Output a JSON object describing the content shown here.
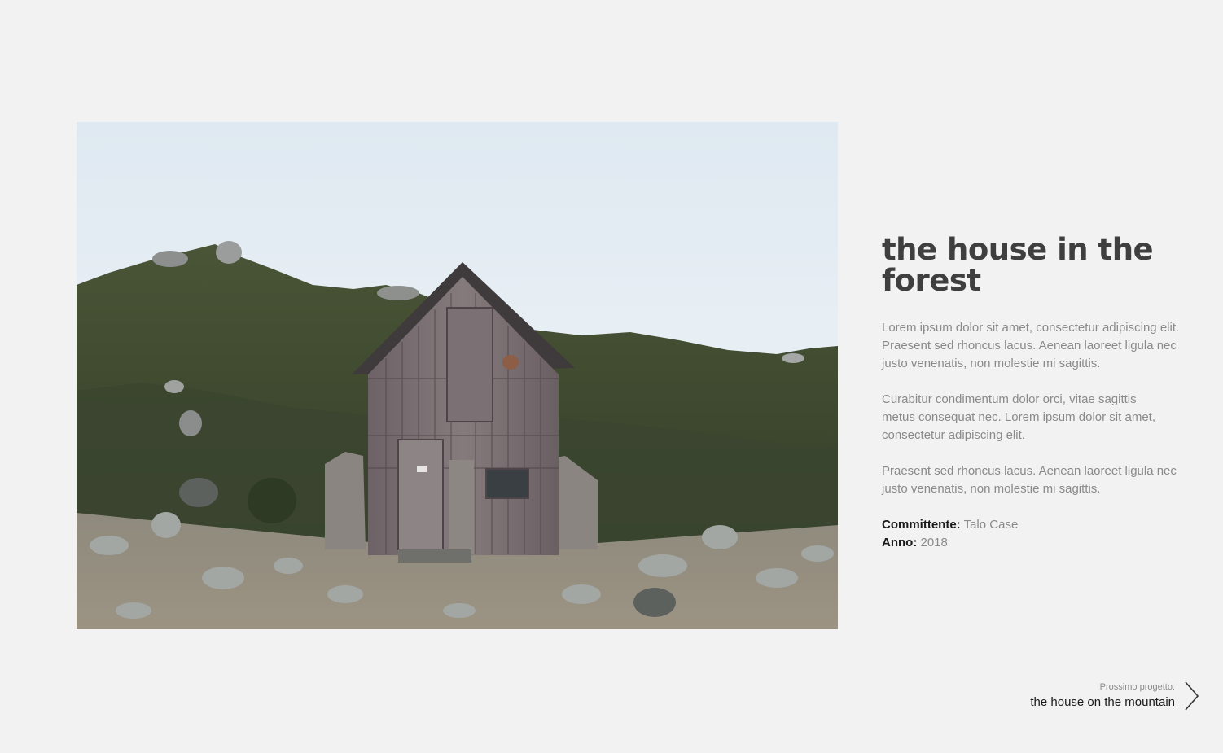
{
  "project": {
    "title": "the house in the forest",
    "paragraphs": [
      "Lorem ipsum dolor sit amet, consectetur adipiscing elit.\nPraesent sed rhoncus lacus.  Aenean laoreet ligula nec\n justo venenatis, non molestie mi sagittis.",
      "Curabitur condimentum dolor orci, vitae sagittis\nmetus consequat nec. Lorem ipsum dolor sit amet,\nconsectetur adipiscing elit.",
      "Praesent sed rhoncus lacus.  Aenean laoreet ligula nec\n justo venenatis, non molestie mi sagittis."
    ],
    "client_label": "Committente:",
    "client_value": "Talo Case",
    "year_label": "Anno:",
    "year_value": "2018"
  },
  "next_project": {
    "caption": "Prossimo progetto:",
    "title": "the house on the mountain",
    "icon": "chevron-right-icon"
  },
  "colors": {
    "background": "#f2f2f2",
    "title": "#3f3f3f",
    "body_text": "#8a8a8a",
    "strong_text": "#1a1a1a"
  }
}
